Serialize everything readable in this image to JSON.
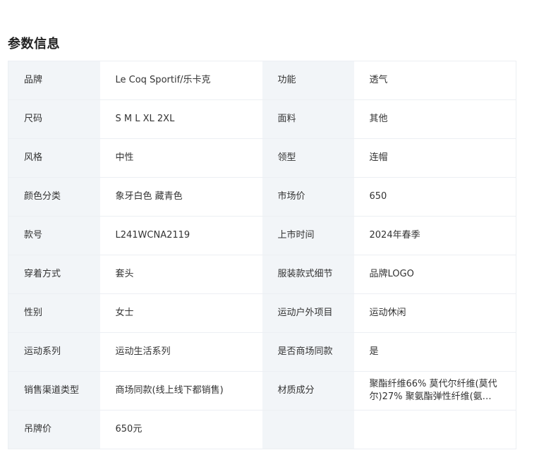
{
  "section": {
    "title": "参数信息"
  },
  "params": [
    {
      "left": {
        "label": "品牌",
        "value": "Le Coq Sportif/乐卡克"
      },
      "right": {
        "label": "功能",
        "value": "透气"
      }
    },
    {
      "left": {
        "label": "尺码",
        "value": "S M L XL 2XL"
      },
      "right": {
        "label": "面料",
        "value": "其他"
      }
    },
    {
      "left": {
        "label": "风格",
        "value": "中性"
      },
      "right": {
        "label": "领型",
        "value": "连帽"
      }
    },
    {
      "left": {
        "label": "颜色分类",
        "value": "象牙白色 藏青色"
      },
      "right": {
        "label": "市场价",
        "value": "650"
      }
    },
    {
      "left": {
        "label": "款号",
        "value": "L241WCNA2119"
      },
      "right": {
        "label": "上市时间",
        "value": "2024年春季"
      }
    },
    {
      "left": {
        "label": "穿着方式",
        "value": "套头"
      },
      "right": {
        "label": "服装款式细节",
        "value": "品牌LOGO"
      }
    },
    {
      "left": {
        "label": "性别",
        "value": "女士"
      },
      "right": {
        "label": "运动户外项目",
        "value": "运动休闲"
      }
    },
    {
      "left": {
        "label": "运动系列",
        "value": "运动生活系列"
      },
      "right": {
        "label": "是否商场同款",
        "value": "是"
      }
    },
    {
      "left": {
        "label": "销售渠道类型",
        "value": "商场同款(线上线下都销售)"
      },
      "right": {
        "label": "材质成分",
        "value": "聚酯纤维66% 莫代尔纤维(莫代尔)27% 聚氨酯弹性纤维(氨纶)..."
      }
    },
    {
      "left": {
        "label": "吊牌价",
        "value": "650元"
      },
      "right": {
        "label": "",
        "value": ""
      }
    }
  ]
}
